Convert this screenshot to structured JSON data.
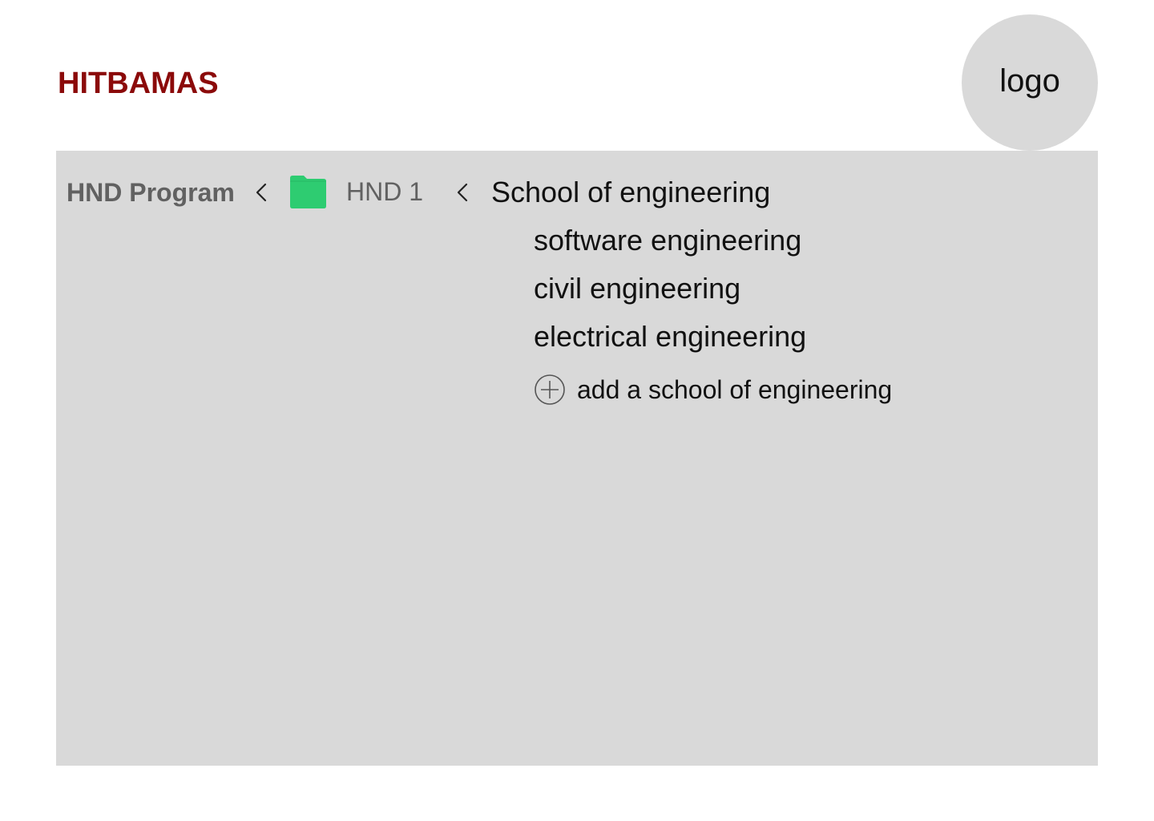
{
  "header": {
    "app_title": "HITBAMAS",
    "logo_text": "logo"
  },
  "breadcrumb": {
    "items": [
      {
        "label": "HND Program"
      },
      {
        "label": "HND 1",
        "icon": "folder-icon"
      },
      {
        "label": "School of engineering"
      }
    ],
    "separator_icon": "chevron-left-icon"
  },
  "schools": [
    {
      "label": "software engineering"
    },
    {
      "label": "civil engineering"
    },
    {
      "label": "electrical engineering"
    }
  ],
  "add_action": {
    "label": "add a school of engineering",
    "icon": "plus-circle-icon"
  },
  "colors": {
    "brand": "#8b0a0a",
    "panel": "#d9d9d9",
    "folder": "#2ecc71",
    "muted_text": "#616161"
  }
}
